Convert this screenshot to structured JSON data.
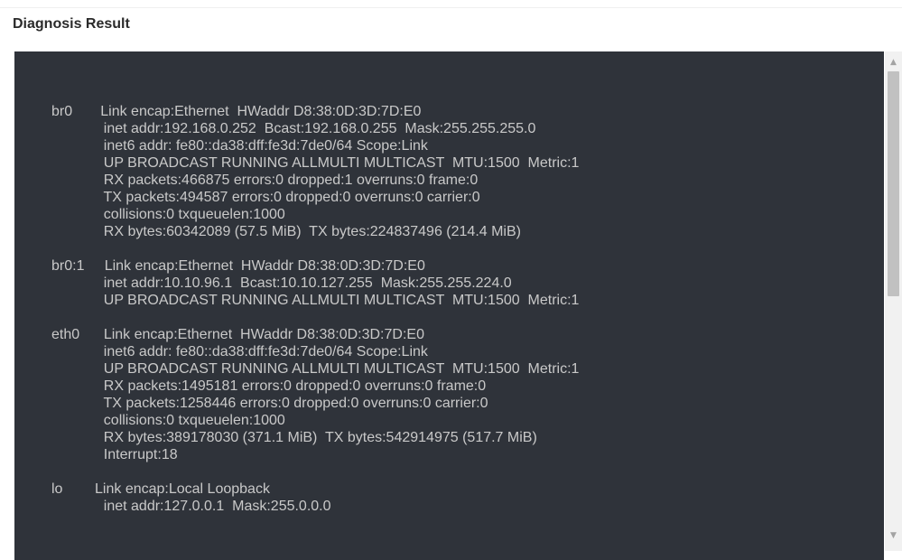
{
  "panel": {
    "title": "Diagnosis Result"
  },
  "console": {
    "output": "br0       Link encap:Ethernet  HWaddr D8:38:0D:3D:7D:E0\n             inet addr:192.168.0.252  Bcast:192.168.0.255  Mask:255.255.255.0\n             inet6 addr: fe80::da38:dff:fe3d:7de0/64 Scope:Link\n             UP BROADCAST RUNNING ALLMULTI MULTICAST  MTU:1500  Metric:1\n             RX packets:466875 errors:0 dropped:1 overruns:0 frame:0\n             TX packets:494587 errors:0 dropped:0 overruns:0 carrier:0\n             collisions:0 txqueuelen:1000\n             RX bytes:60342089 (57.5 MiB)  TX bytes:224837496 (214.4 MiB)\n\nbr0:1     Link encap:Ethernet  HWaddr D8:38:0D:3D:7D:E0\n             inet addr:10.10.96.1  Bcast:10.10.127.255  Mask:255.255.224.0\n             UP BROADCAST RUNNING ALLMULTI MULTICAST  MTU:1500  Metric:1\n\neth0      Link encap:Ethernet  HWaddr D8:38:0D:3D:7D:E0\n             inet6 addr: fe80::da38:dff:fe3d:7de0/64 Scope:Link\n             UP BROADCAST RUNNING ALLMULTI MULTICAST  MTU:1500  Metric:1\n             RX packets:1495181 errors:0 dropped:0 overruns:0 frame:0\n             TX packets:1258446 errors:0 dropped:0 overruns:0 carrier:0\n             collisions:0 txqueuelen:1000\n             RX bytes:389178030 (371.1 MiB)  TX bytes:542914975 (517.7 MiB)\n             Interrupt:18\n\nlo        Link encap:Local Loopback\n             inet addr:127.0.0.1  Mask:255.0.0.0"
  },
  "scrollbar": {
    "up_icon": "chevron-up-icon",
    "down_icon": "chevron-down-icon",
    "up_glyph": "▲",
    "down_glyph": "▼"
  },
  "colors": {
    "console_background": "#2f333a",
    "console_text": "#c9c9c9",
    "title_text": "#2a2a2a"
  }
}
